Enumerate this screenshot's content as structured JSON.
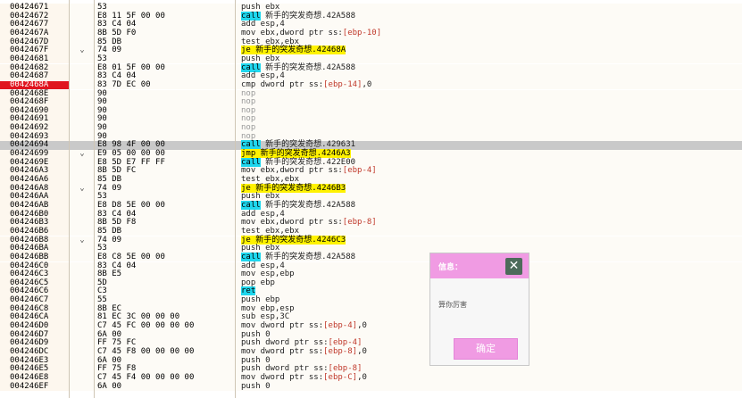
{
  "rows": [
    {
      "addr": "00424671",
      "arrow": "",
      "hex": "53",
      "asm": [
        {
          "t": "push ebx",
          "c": "op"
        }
      ]
    },
    {
      "addr": "00424672",
      "arrow": "",
      "hex": "E8 11 5F 00 00",
      "asm": [
        {
          "t": "call",
          "c": "call"
        },
        {
          "t": " 新手的突发奇想.42A588",
          "c": "op"
        }
      ]
    },
    {
      "addr": "00424677",
      "arrow": "",
      "hex": "83 C4 04",
      "asm": [
        {
          "t": "add esp,4",
          "c": "op"
        }
      ]
    },
    {
      "addr": "0042467A",
      "arrow": "",
      "hex": "8B 5D F0",
      "asm": [
        {
          "t": "mov ebx,dword ptr ss:",
          "c": "op"
        },
        {
          "t": "[ebp-10]",
          "c": "red"
        }
      ]
    },
    {
      "addr": "0042467D",
      "arrow": "",
      "hex": "85 DB",
      "asm": [
        {
          "t": "test ebx,ebx",
          "c": "op"
        }
      ]
    },
    {
      "addr": "0042467F",
      "arrow": "⌄",
      "hex": "74 09",
      "asm": [
        {
          "t": "je 新手的突发奇想.42468A",
          "c": "jmp"
        }
      ]
    },
    {
      "addr": "00424681",
      "arrow": "",
      "hex": "53",
      "asm": [
        {
          "t": "push ebx",
          "c": "op"
        }
      ]
    },
    {
      "addr": "00424682",
      "arrow": "",
      "hex": "E8 01 5F 00 00",
      "asm": [
        {
          "t": "call",
          "c": "call"
        },
        {
          "t": " 新手的突发奇想.42A588",
          "c": "op"
        }
      ]
    },
    {
      "addr": "00424687",
      "arrow": "",
      "hex": "83 C4 04",
      "asm": [
        {
          "t": "add esp,4",
          "c": "op"
        }
      ]
    },
    {
      "addr": "0042468A",
      "arrow": "",
      "hex": "83 7D EC 00",
      "asm": [
        {
          "t": "cmp dword ptr ss:",
          "c": "op"
        },
        {
          "t": "[ebp-14]",
          "c": "red"
        },
        {
          "t": ",0",
          "c": "op"
        }
      ],
      "bp": true
    },
    {
      "addr": "0042468E",
      "arrow": "",
      "hex": "90",
      "asm": [
        {
          "t": "nop",
          "c": "grey"
        }
      ]
    },
    {
      "addr": "0042468F",
      "arrow": "",
      "hex": "90",
      "asm": [
        {
          "t": "nop",
          "c": "grey"
        }
      ]
    },
    {
      "addr": "00424690",
      "arrow": "",
      "hex": "90",
      "asm": [
        {
          "t": "nop",
          "c": "grey"
        }
      ]
    },
    {
      "addr": "00424691",
      "arrow": "",
      "hex": "90",
      "asm": [
        {
          "t": "nop",
          "c": "grey"
        }
      ]
    },
    {
      "addr": "00424692",
      "arrow": "",
      "hex": "90",
      "asm": [
        {
          "t": "nop",
          "c": "grey"
        }
      ]
    },
    {
      "addr": "00424693",
      "arrow": "",
      "hex": "90",
      "asm": [
        {
          "t": "nop",
          "c": "grey"
        }
      ]
    },
    {
      "addr": "00424694",
      "arrow": "",
      "hex": "E8 98 4F 00 00",
      "asm": [
        {
          "t": "call",
          "c": "call"
        },
        {
          "t": " 新手的突发奇想.429631",
          "c": "op"
        }
      ],
      "sel": true
    },
    {
      "addr": "00424699",
      "arrow": "⌄",
      "hex": "E9 05 00 00 00",
      "asm": [
        {
          "t": "jmp 新手的突发奇想.4246A3",
          "c": "jmp"
        }
      ]
    },
    {
      "addr": "0042469E",
      "arrow": "",
      "hex": "E8 5D E7 FF FF",
      "asm": [
        {
          "t": "call",
          "c": "call"
        },
        {
          "t": " 新手的突发奇想.422E00",
          "c": "op"
        }
      ]
    },
    {
      "addr": "004246A3",
      "arrow": "",
      "hex": "8B 5D FC",
      "asm": [
        {
          "t": "mov ebx,dword ptr ss:",
          "c": "op"
        },
        {
          "t": "[ebp-4]",
          "c": "red"
        }
      ]
    },
    {
      "addr": "004246A6",
      "arrow": "",
      "hex": "85 DB",
      "asm": [
        {
          "t": "test ebx,ebx",
          "c": "op"
        }
      ]
    },
    {
      "addr": "004246A8",
      "arrow": "⌄",
      "hex": "74 09",
      "asm": [
        {
          "t": "je 新手的突发奇想.4246B3",
          "c": "jmp"
        }
      ]
    },
    {
      "addr": "004246AA",
      "arrow": "",
      "hex": "53",
      "asm": [
        {
          "t": "push ebx",
          "c": "op"
        }
      ]
    },
    {
      "addr": "004246AB",
      "arrow": "",
      "hex": "E8 D8 5E 00 00",
      "asm": [
        {
          "t": "call",
          "c": "call"
        },
        {
          "t": " 新手的突发奇想.42A588",
          "c": "op"
        }
      ]
    },
    {
      "addr": "004246B0",
      "arrow": "",
      "hex": "83 C4 04",
      "asm": [
        {
          "t": "add esp,4",
          "c": "op"
        }
      ]
    },
    {
      "addr": "004246B3",
      "arrow": "",
      "hex": "8B 5D F8",
      "asm": [
        {
          "t": "mov ebx,dword ptr ss:",
          "c": "op"
        },
        {
          "t": "[ebp-8]",
          "c": "red"
        }
      ]
    },
    {
      "addr": "004246B6",
      "arrow": "",
      "hex": "85 DB",
      "asm": [
        {
          "t": "test ebx,ebx",
          "c": "op"
        }
      ]
    },
    {
      "addr": "004246B8",
      "arrow": "⌄",
      "hex": "74 09",
      "asm": [
        {
          "t": "je 新手的突发奇想.4246C3",
          "c": "jmp"
        }
      ]
    },
    {
      "addr": "004246BA",
      "arrow": "",
      "hex": "53",
      "asm": [
        {
          "t": "push ebx",
          "c": "op"
        }
      ]
    },
    {
      "addr": "004246BB",
      "arrow": "",
      "hex": "E8 C8 5E 00 00",
      "asm": [
        {
          "t": "call",
          "c": "call"
        },
        {
          "t": " 新手的突发奇想.42A588",
          "c": "op"
        }
      ]
    },
    {
      "addr": "004246C0",
      "arrow": "",
      "hex": "83 C4 04",
      "asm": [
        {
          "t": "add esp,4",
          "c": "op"
        }
      ]
    },
    {
      "addr": "004246C3",
      "arrow": "",
      "hex": "8B E5",
      "asm": [
        {
          "t": "mov esp,ebp",
          "c": "op"
        }
      ]
    },
    {
      "addr": "004246C5",
      "arrow": "",
      "hex": "5D",
      "asm": [
        {
          "t": "pop ebp",
          "c": "op"
        }
      ]
    },
    {
      "addr": "004246C6",
      "arrow": "",
      "hex": "C3",
      "asm": [
        {
          "t": "ret",
          "c": "call"
        }
      ]
    },
    {
      "addr": "004246C7",
      "arrow": "",
      "hex": "55",
      "asm": [
        {
          "t": "push ebp",
          "c": "op"
        }
      ]
    },
    {
      "addr": "004246C8",
      "arrow": "",
      "hex": "8B EC",
      "asm": [
        {
          "t": "mov ebp,esp",
          "c": "op"
        }
      ]
    },
    {
      "addr": "004246CA",
      "arrow": "",
      "hex": "81 EC 3C 00 00 00",
      "asm": [
        {
          "t": "sub esp,3C",
          "c": "op"
        }
      ]
    },
    {
      "addr": "004246D0",
      "arrow": "",
      "hex": "C7 45 FC 00 00 00 00",
      "asm": [
        {
          "t": "mov dword ptr ss:",
          "c": "op"
        },
        {
          "t": "[ebp-4]",
          "c": "red"
        },
        {
          "t": ",0",
          "c": "op"
        }
      ]
    },
    {
      "addr": "004246D7",
      "arrow": "",
      "hex": "6A 00",
      "asm": [
        {
          "t": "push 0",
          "c": "op"
        }
      ]
    },
    {
      "addr": "004246D9",
      "arrow": "",
      "hex": "FF 75 FC",
      "asm": [
        {
          "t": "push dword ptr ss:",
          "c": "op"
        },
        {
          "t": "[ebp-4]",
          "c": "red"
        }
      ]
    },
    {
      "addr": "004246DC",
      "arrow": "",
      "hex": "C7 45 F8 00 00 00 00",
      "asm": [
        {
          "t": "mov dword ptr ss:",
          "c": "op"
        },
        {
          "t": "[ebp-8]",
          "c": "red"
        },
        {
          "t": ",0",
          "c": "op"
        }
      ]
    },
    {
      "addr": "004246E3",
      "arrow": "",
      "hex": "6A 00",
      "asm": [
        {
          "t": "push 0",
          "c": "op"
        }
      ]
    },
    {
      "addr": "004246E5",
      "arrow": "",
      "hex": "FF 75 F8",
      "asm": [
        {
          "t": "push dword ptr ss:",
          "c": "op"
        },
        {
          "t": "[ebp-8]",
          "c": "red"
        }
      ]
    },
    {
      "addr": "004246E8",
      "arrow": "",
      "hex": "C7 45 F4 00 00 00 00",
      "asm": [
        {
          "t": "mov dword ptr ss:",
          "c": "op"
        },
        {
          "t": "[ebp-C]",
          "c": "red"
        },
        {
          "t": ",0",
          "c": "op"
        }
      ]
    },
    {
      "addr": "004246EF",
      "arrow": "",
      "hex": "6A 00",
      "asm": [
        {
          "t": "push 0",
          "c": "op"
        }
      ]
    }
  ],
  "dialog": {
    "title": "信息：",
    "close": "✕",
    "message": "算你厉害",
    "ok_label": "确定"
  }
}
